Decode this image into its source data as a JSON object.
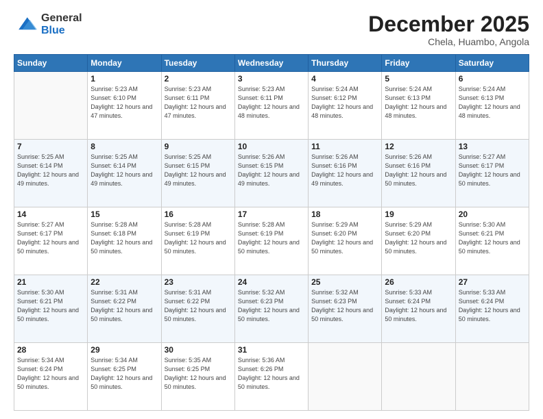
{
  "header": {
    "logo_general": "General",
    "logo_blue": "Blue",
    "month": "December 2025",
    "location": "Chela, Huambo, Angola"
  },
  "weekdays": [
    "Sunday",
    "Monday",
    "Tuesday",
    "Wednesday",
    "Thursday",
    "Friday",
    "Saturday"
  ],
  "weeks": [
    [
      {
        "day": null
      },
      {
        "day": "1",
        "sunrise": "5:23 AM",
        "sunset": "6:10 PM",
        "daylight": "12 hours and 47 minutes."
      },
      {
        "day": "2",
        "sunrise": "5:23 AM",
        "sunset": "6:11 PM",
        "daylight": "12 hours and 47 minutes."
      },
      {
        "day": "3",
        "sunrise": "5:23 AM",
        "sunset": "6:11 PM",
        "daylight": "12 hours and 48 minutes."
      },
      {
        "day": "4",
        "sunrise": "5:24 AM",
        "sunset": "6:12 PM",
        "daylight": "12 hours and 48 minutes."
      },
      {
        "day": "5",
        "sunrise": "5:24 AM",
        "sunset": "6:13 PM",
        "daylight": "12 hours and 48 minutes."
      },
      {
        "day": "6",
        "sunrise": "5:24 AM",
        "sunset": "6:13 PM",
        "daylight": "12 hours and 48 minutes."
      }
    ],
    [
      {
        "day": "7",
        "sunrise": "5:25 AM",
        "sunset": "6:14 PM",
        "daylight": "12 hours and 49 minutes."
      },
      {
        "day": "8",
        "sunrise": "5:25 AM",
        "sunset": "6:14 PM",
        "daylight": "12 hours and 49 minutes."
      },
      {
        "day": "9",
        "sunrise": "5:25 AM",
        "sunset": "6:15 PM",
        "daylight": "12 hours and 49 minutes."
      },
      {
        "day": "10",
        "sunrise": "5:26 AM",
        "sunset": "6:15 PM",
        "daylight": "12 hours and 49 minutes."
      },
      {
        "day": "11",
        "sunrise": "5:26 AM",
        "sunset": "6:16 PM",
        "daylight": "12 hours and 49 minutes."
      },
      {
        "day": "12",
        "sunrise": "5:26 AM",
        "sunset": "6:16 PM",
        "daylight": "12 hours and 50 minutes."
      },
      {
        "day": "13",
        "sunrise": "5:27 AM",
        "sunset": "6:17 PM",
        "daylight": "12 hours and 50 minutes."
      }
    ],
    [
      {
        "day": "14",
        "sunrise": "5:27 AM",
        "sunset": "6:17 PM",
        "daylight": "12 hours and 50 minutes."
      },
      {
        "day": "15",
        "sunrise": "5:28 AM",
        "sunset": "6:18 PM",
        "daylight": "12 hours and 50 minutes."
      },
      {
        "day": "16",
        "sunrise": "5:28 AM",
        "sunset": "6:19 PM",
        "daylight": "12 hours and 50 minutes."
      },
      {
        "day": "17",
        "sunrise": "5:28 AM",
        "sunset": "6:19 PM",
        "daylight": "12 hours and 50 minutes."
      },
      {
        "day": "18",
        "sunrise": "5:29 AM",
        "sunset": "6:20 PM",
        "daylight": "12 hours and 50 minutes."
      },
      {
        "day": "19",
        "sunrise": "5:29 AM",
        "sunset": "6:20 PM",
        "daylight": "12 hours and 50 minutes."
      },
      {
        "day": "20",
        "sunrise": "5:30 AM",
        "sunset": "6:21 PM",
        "daylight": "12 hours and 50 minutes."
      }
    ],
    [
      {
        "day": "21",
        "sunrise": "5:30 AM",
        "sunset": "6:21 PM",
        "daylight": "12 hours and 50 minutes."
      },
      {
        "day": "22",
        "sunrise": "5:31 AM",
        "sunset": "6:22 PM",
        "daylight": "12 hours and 50 minutes."
      },
      {
        "day": "23",
        "sunrise": "5:31 AM",
        "sunset": "6:22 PM",
        "daylight": "12 hours and 50 minutes."
      },
      {
        "day": "24",
        "sunrise": "5:32 AM",
        "sunset": "6:23 PM",
        "daylight": "12 hours and 50 minutes."
      },
      {
        "day": "25",
        "sunrise": "5:32 AM",
        "sunset": "6:23 PM",
        "daylight": "12 hours and 50 minutes."
      },
      {
        "day": "26",
        "sunrise": "5:33 AM",
        "sunset": "6:24 PM",
        "daylight": "12 hours and 50 minutes."
      },
      {
        "day": "27",
        "sunrise": "5:33 AM",
        "sunset": "6:24 PM",
        "daylight": "12 hours and 50 minutes."
      }
    ],
    [
      {
        "day": "28",
        "sunrise": "5:34 AM",
        "sunset": "6:24 PM",
        "daylight": "12 hours and 50 minutes."
      },
      {
        "day": "29",
        "sunrise": "5:34 AM",
        "sunset": "6:25 PM",
        "daylight": "12 hours and 50 minutes."
      },
      {
        "day": "30",
        "sunrise": "5:35 AM",
        "sunset": "6:25 PM",
        "daylight": "12 hours and 50 minutes."
      },
      {
        "day": "31",
        "sunrise": "5:36 AM",
        "sunset": "6:26 PM",
        "daylight": "12 hours and 50 minutes."
      },
      {
        "day": null
      },
      {
        "day": null
      },
      {
        "day": null
      }
    ]
  ]
}
